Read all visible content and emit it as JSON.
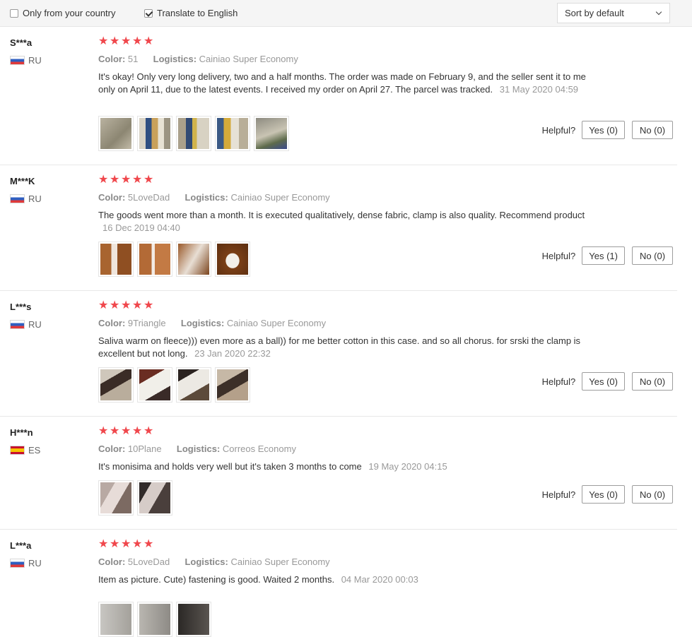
{
  "filters": {
    "only_country_label": "Only from your country",
    "only_country_checked": false,
    "translate_label": "Translate to English",
    "translate_checked": true,
    "sort_label": "Sort by default"
  },
  "helpful_label": "Helpful?",
  "reviews": [
    {
      "user": "S***a",
      "country": "RU",
      "rating": 5,
      "color_key": "Color:",
      "color_val": "51",
      "logistics_key": "Logistics:",
      "logistics_val": "Cainiao Super Economy",
      "text": "It's okay! Only very long delivery, two and a half months. The order was made on February 9, and the seller sent it to me only on April 11, due to the latest events. I received my order on April 27. The parcel was tracked.",
      "date": "31 May 2020 04:59",
      "images": 5,
      "yes": "Yes (0)",
      "no": "No (0)"
    },
    {
      "user": "M***K",
      "country": "RU",
      "rating": 5,
      "color_key": "Color:",
      "color_val": "5LoveDad",
      "logistics_key": "Logistics:",
      "logistics_val": "Cainiao Super Economy",
      "text": "The goods went more than a month. It is executed qualitatively, dense fabric, clamp is also quality. Recommend product",
      "date": "16 Dec 2019 04:40",
      "images": 4,
      "yes": "Yes (1)",
      "no": "No (0)"
    },
    {
      "user": "L***s",
      "country": "RU",
      "rating": 5,
      "color_key": "Color:",
      "color_val": "9Triangle",
      "logistics_key": "Logistics:",
      "logistics_val": "Cainiao Super Economy",
      "text": "Saliva warm on fleece))) even more as a ball)) for me better cotton in this case. and so all chorus. for srski the clamp is excellent but not long.",
      "date": "23 Jan 2020 22:32",
      "images": 4,
      "yes": "Yes (0)",
      "no": "No (0)"
    },
    {
      "user": "H***n",
      "country": "ES",
      "rating": 5,
      "color_key": "Color:",
      "color_val": "10Plane",
      "logistics_key": "Logistics:",
      "logistics_val": "Correos Economy",
      "text": "It's monisima and holds very well but it's taken 3 months to come",
      "date": "19 May 2020 04:15",
      "images": 2,
      "yes": "Yes (0)",
      "no": "No (0)"
    },
    {
      "user": "L***a",
      "country": "RU",
      "rating": 5,
      "color_key": "Color:",
      "color_val": "5LoveDad",
      "logistics_key": "Logistics:",
      "logistics_val": "Cainiao Super Economy",
      "text": "Item as picture. Cute) fastening is good. Waited 2 months.",
      "date": "04 Mar 2020 00:03"
    }
  ],
  "colors": {
    "star": "#f0474c",
    "muted": "#999999",
    "text": "#333333"
  }
}
